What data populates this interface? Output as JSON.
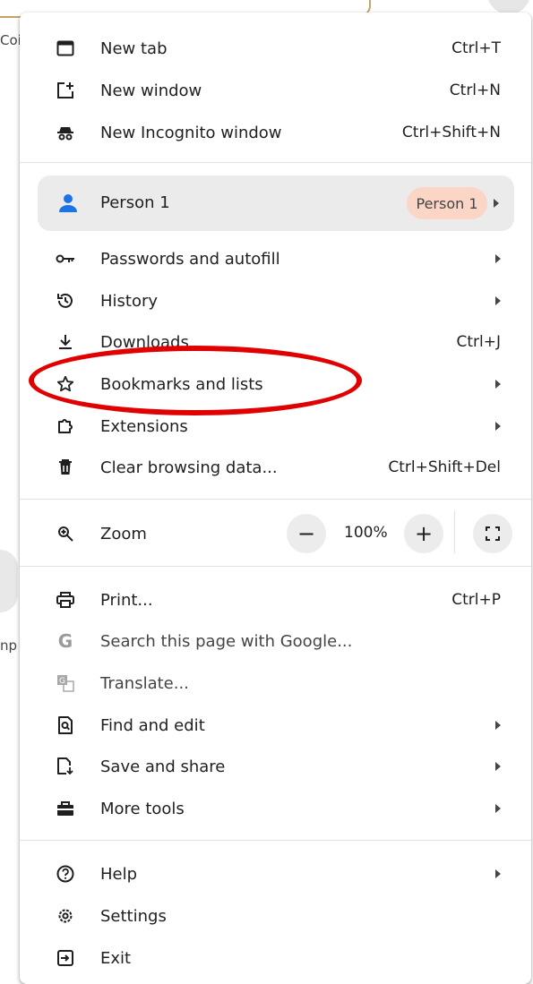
{
  "background": {
    "left_text_1": "Coi",
    "left_text_2": "np"
  },
  "menu": {
    "new_tab": {
      "label": "New tab",
      "shortcut": "Ctrl+T"
    },
    "new_window": {
      "label": "New window",
      "shortcut": "Ctrl+N"
    },
    "new_incognito": {
      "label": "New Incognito window",
      "shortcut": "Ctrl+Shift+N"
    },
    "profile": {
      "label": "Person 1",
      "badge": "Person 1"
    },
    "passwords": {
      "label": "Passwords and autofill"
    },
    "history": {
      "label": "History"
    },
    "downloads": {
      "label": "Downloads",
      "shortcut": "Ctrl+J"
    },
    "bookmarks": {
      "label": "Bookmarks and lists"
    },
    "extensions": {
      "label": "Extensions"
    },
    "clear_data": {
      "label": "Clear browsing data...",
      "shortcut": "Ctrl+Shift+Del"
    },
    "zoom": {
      "label": "Zoom",
      "minus": "−",
      "value": "100%",
      "plus": "+"
    },
    "print": {
      "label": "Print...",
      "shortcut": "Ctrl+P"
    },
    "search_google": {
      "label": "Search this page with Google..."
    },
    "translate": {
      "label": "Translate..."
    },
    "find_edit": {
      "label": "Find and edit"
    },
    "save_share": {
      "label": "Save and share"
    },
    "more_tools": {
      "label": "More tools"
    },
    "help": {
      "label": "Help"
    },
    "settings": {
      "label": "Settings"
    },
    "exit": {
      "label": "Exit"
    }
  },
  "colors": {
    "highlight": "#e00000",
    "profile_badge": "#fbd6c6",
    "profile_avatar": "#1a73e8"
  }
}
